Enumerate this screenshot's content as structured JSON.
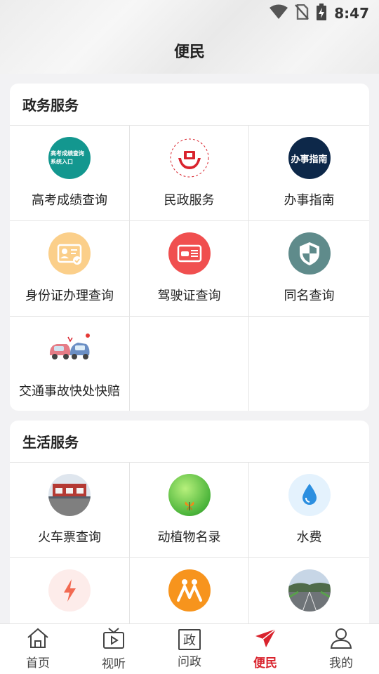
{
  "status": {
    "time": "8:47"
  },
  "header": {
    "title": "便民"
  },
  "gov": {
    "title": "政务服务",
    "items": [
      {
        "label": "高考成绩查询",
        "icon": "gaokao-score-icon",
        "icon_text": [
          "高考成绩查询",
          "系统入口"
        ]
      },
      {
        "label": "民政服务",
        "icon": "civil-affairs-emblem-icon"
      },
      {
        "label": "办事指南",
        "icon": "guide-icon",
        "icon_text": "办事指南"
      },
      {
        "label": "身份证办理查询",
        "icon": "id-card-icon"
      },
      {
        "label": "驾驶证查询",
        "icon": "driver-license-icon"
      },
      {
        "label": "同名查询",
        "icon": "same-name-shield-icon"
      },
      {
        "label": "交通事故快处快赔",
        "icon": "car-accident-icon"
      }
    ]
  },
  "life": {
    "title": "生活服务",
    "items": [
      {
        "label": "火车票查询",
        "icon": "train-station-photo-icon"
      },
      {
        "label": "动植物名录",
        "icon": "plant-butterfly-icon"
      },
      {
        "label": "水费",
        "icon": "water-drop-icon"
      },
      {
        "label": "",
        "icon": "electricity-bolt-icon"
      },
      {
        "label": "",
        "icon": "people-icon"
      },
      {
        "label": "",
        "icon": "highway-photo-icon"
      }
    ]
  },
  "tabs": [
    {
      "label": "首页",
      "icon": "home-icon"
    },
    {
      "label": "视听",
      "icon": "tv-play-icon"
    },
    {
      "label": "问政",
      "icon": "zheng-box-icon",
      "icon_text": "政"
    },
    {
      "label": "便民",
      "icon": "paper-plane-icon",
      "active": true
    },
    {
      "label": "我的",
      "icon": "user-icon"
    }
  ],
  "colors": {
    "accent": "#d9232d",
    "bg": "#f2f2f4"
  }
}
